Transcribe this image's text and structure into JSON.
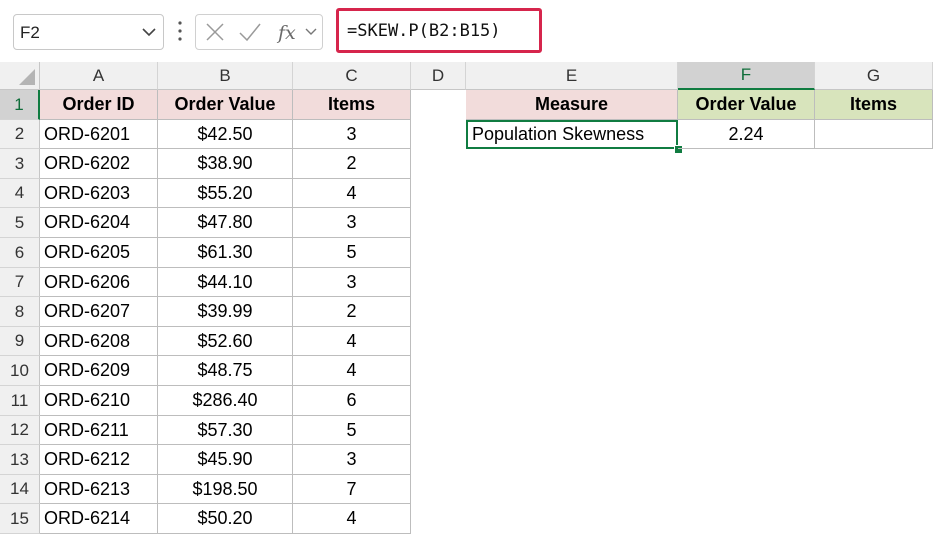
{
  "name_box": {
    "value": "F2"
  },
  "formula": {
    "text": "=SKEW.P(B2:B15)"
  },
  "columns": [
    "A",
    "B",
    "C",
    "D",
    "E",
    "F",
    "G"
  ],
  "rows": [
    "1",
    "2",
    "3",
    "4",
    "5",
    "6",
    "7",
    "8",
    "9",
    "10",
    "11",
    "12",
    "13",
    "14",
    "15"
  ],
  "table": {
    "headers": [
      "Order ID",
      "Order Value",
      "Items"
    ],
    "rows": [
      [
        "ORD-6201",
        "$42.50",
        "3"
      ],
      [
        "ORD-6202",
        "$38.90",
        "2"
      ],
      [
        "ORD-6203",
        "$55.20",
        "4"
      ],
      [
        "ORD-6204",
        "$47.80",
        "3"
      ],
      [
        "ORD-6205",
        "$61.30",
        "5"
      ],
      [
        "ORD-6206",
        "$44.10",
        "3"
      ],
      [
        "ORD-6207",
        "$39.99",
        "2"
      ],
      [
        "ORD-6208",
        "$52.60",
        "4"
      ],
      [
        "ORD-6209",
        "$48.75",
        "4"
      ],
      [
        "ORD-6210",
        "$286.40",
        "6"
      ],
      [
        "ORD-6211",
        "$57.30",
        "5"
      ],
      [
        "ORD-6212",
        "$45.90",
        "3"
      ],
      [
        "ORD-6213",
        "$198.50",
        "7"
      ],
      [
        "ORD-6214",
        "$50.20",
        "4"
      ]
    ]
  },
  "summary": {
    "headers": [
      "Measure",
      "Order Value",
      "Items"
    ],
    "row": [
      "Population Skewness",
      "2.24",
      ""
    ]
  },
  "icons": {
    "cancel": "cancel-icon",
    "enter": "checkmark-icon",
    "function": "fx-icon"
  },
  "colors": {
    "pink_header": "#f2dcdb",
    "green_header": "#d8e4bc",
    "selection": "#107c41",
    "formula_highlight": "#d6254c"
  }
}
